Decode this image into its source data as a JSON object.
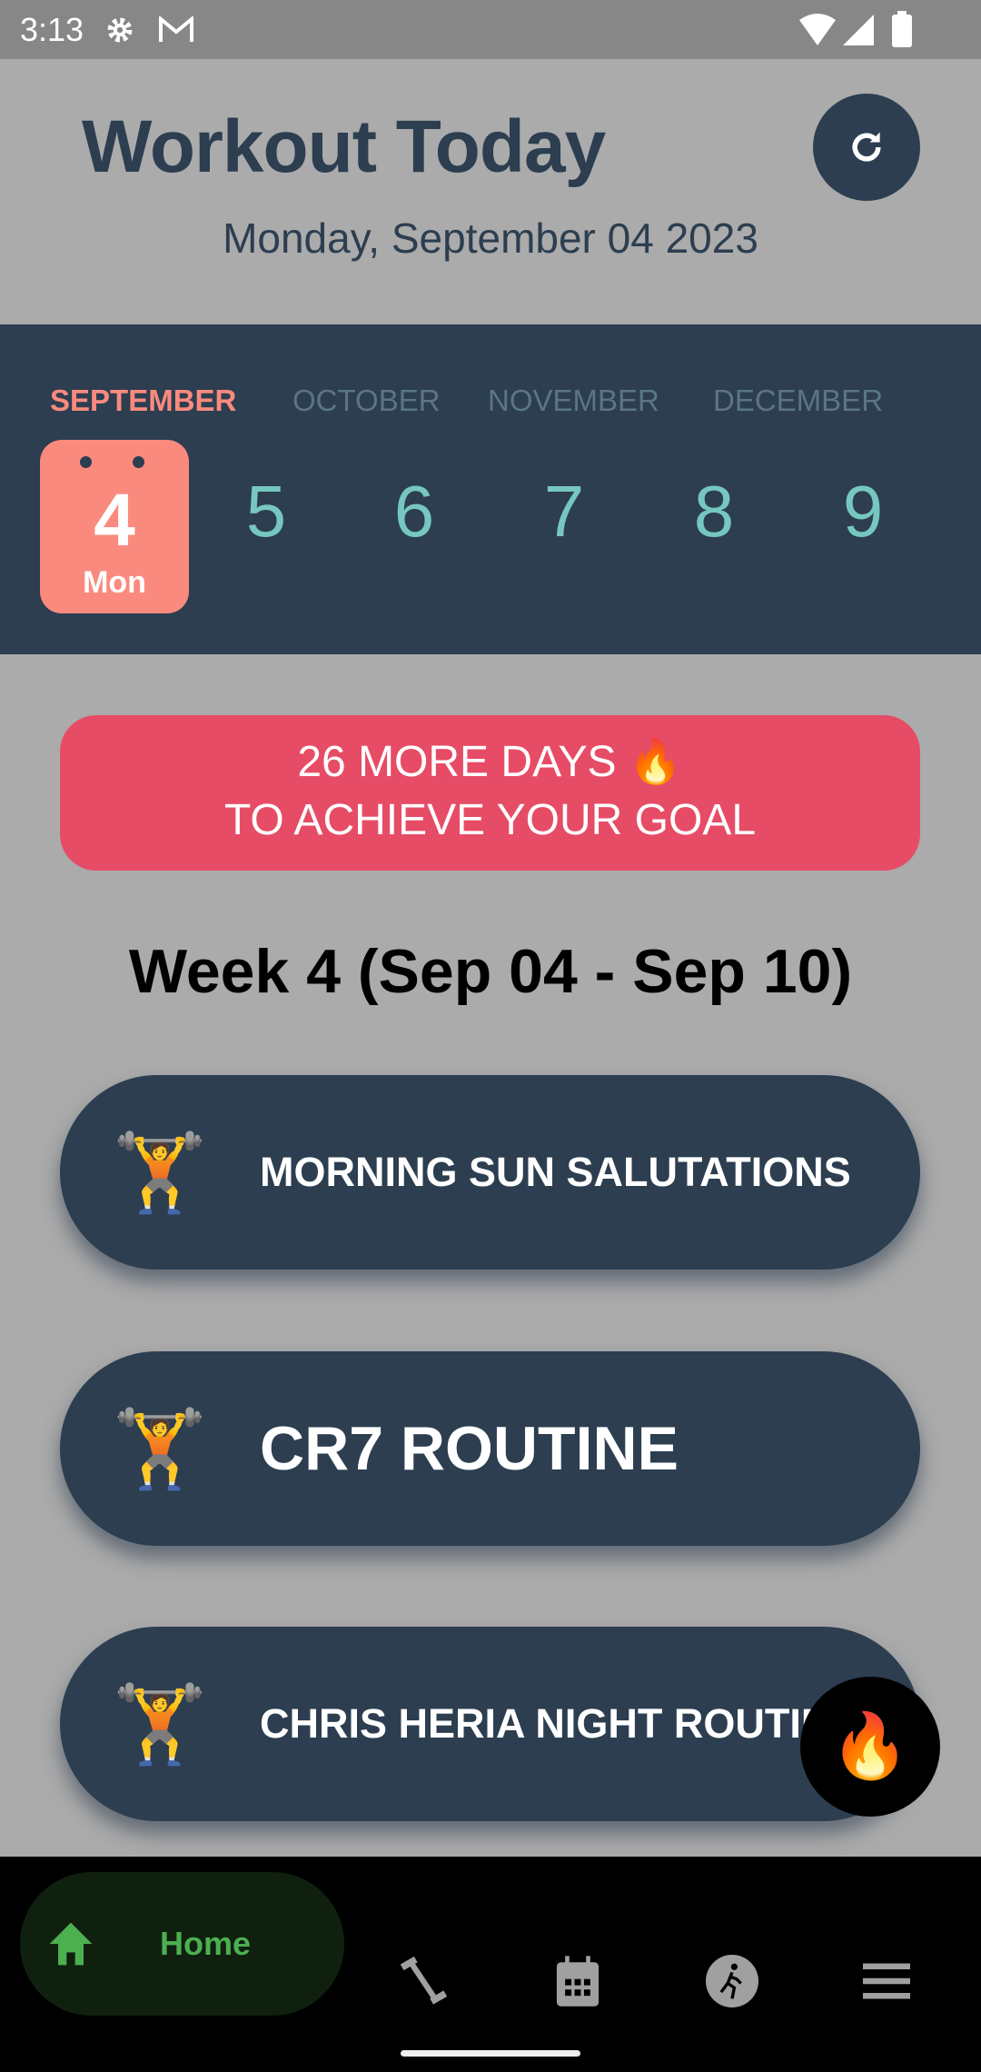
{
  "status_bar": {
    "time": "3:13"
  },
  "header": {
    "title": "Workout Today",
    "date": "Monday, September 04 2023",
    "refresh_icon": "refresh-icon"
  },
  "calendar": {
    "months": [
      "SEPTEMBER",
      "OCTOBER",
      "NOVEMBER",
      "DECEMBER"
    ],
    "active_month": "SEPTEMBER",
    "selected_day": {
      "number": "4",
      "weekday": "Mon"
    },
    "days": [
      "5",
      "6",
      "7",
      "8",
      "9"
    ],
    "colors": {
      "selected": "#fa8a7e",
      "day": "#76c7c0",
      "background": "#2c3e50"
    }
  },
  "banner": {
    "line1": "26 MORE DAYS 🔥",
    "line2": "TO ACHIEVE YOUR GOAL",
    "color": "#e74c66"
  },
  "week_heading": "Week 4 (Sep 04 - Sep 10)",
  "workouts": [
    {
      "emoji": "🏋️",
      "name": "MORNING SUN SALUTATIONS"
    },
    {
      "emoji": "🏋️",
      "name": "CR7 ROUTINE"
    },
    {
      "emoji": "🏋️",
      "name": "CHRIS HERIA NIGHT ROUTINE"
    }
  ],
  "fab": {
    "emoji": "🔥"
  },
  "bottom_nav": {
    "home_label": "Home",
    "items": [
      "home-icon",
      "dumbbell-icon",
      "calendar-icon",
      "running-icon",
      "menu-icon"
    ],
    "active_color": "#4caf50"
  }
}
